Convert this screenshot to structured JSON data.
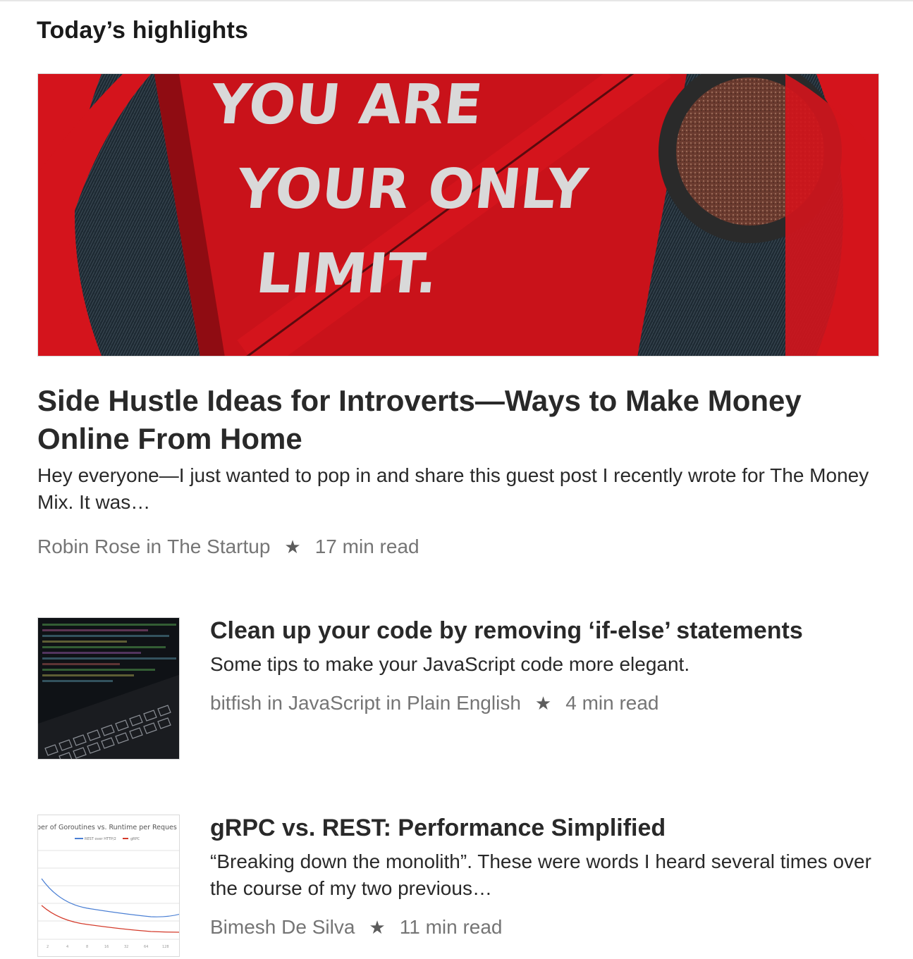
{
  "section": {
    "title": "Today’s highlights"
  },
  "hero": {
    "image_text": [
      "YOU ARE",
      "YOUR ONLY",
      "LIMIT."
    ],
    "title": "Side Hustle Ideas for Introverts—Ways to Make Money Online From Home",
    "snippet": "Hey everyone—I just wanted to pop in and share this guest post I recently wrote for The Money Mix. It was…",
    "author": "Robin Rose",
    "connector": "in",
    "publication": "The Startup",
    "star_icon": "star-icon",
    "read_time": "17 min read"
  },
  "items": [
    {
      "title": "Clean up your code by removing ‘if-else’ statements",
      "snippet": "Some tips to make your JavaScript code more elegant.",
      "author": "bitfish",
      "connector": "in",
      "publication": "JavaScript in Plain English",
      "star_icon": "star-icon",
      "read_time": "4 min read"
    },
    {
      "title": "gRPC vs. REST: Performance Simplified",
      "snippet": "“Breaking down the monolith”. These were words I heard several times over the course of my two previous…",
      "author": "Bimesh De Silva",
      "star_icon": "star-icon",
      "read_time": "11 min read",
      "thumb_chart": {
        "title": "ber of Goroutines vs. Runtime per Reques",
        "legend": [
          "REST over HTTP/2",
          "gRPC"
        ],
        "x_ticks": [
          "2",
          "4",
          "8",
          "16",
          "32",
          "64",
          "128"
        ]
      }
    }
  ],
  "colors": {
    "accent_red": "#d4141c",
    "meta_gray": "#757575",
    "text": "#292929"
  }
}
